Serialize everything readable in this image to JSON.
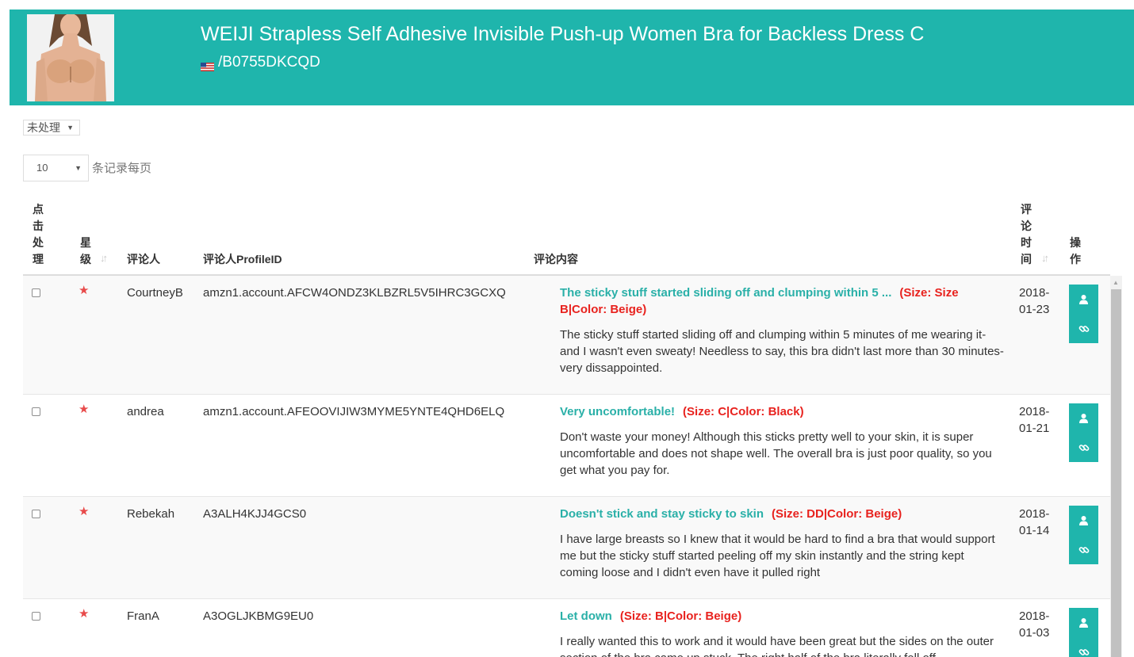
{
  "product": {
    "title": "WEIJI Strapless Self Adhesive Invisible Push-up Women Bra for Backless Dress C",
    "asin": "/B0755DKCQD",
    "flag_icon": "us-flag-icon"
  },
  "filters": {
    "status_value": "未处理",
    "page_size_value": "10",
    "page_size_label": "条记录每页"
  },
  "table": {
    "headers": {
      "process": "点击处理",
      "stars": "星级",
      "reviewer": "评论人",
      "profile_id": "评论人ProfileID",
      "content": "评论内容",
      "time": "评论时间",
      "actions": "操作"
    },
    "rows": [
      {
        "reviewer": "CourtneyB",
        "profile_id": "amzn1.account.AFCW4ONDZ3KLBZRL5V5IHRC3GCXQ",
        "title": "The sticky stuff started sliding off and clumping within 5 ...",
        "variant": "(Size: Size B|Color: Beige)",
        "body": "The sticky stuff started sliding off and clumping within 5 minutes of me wearing it- and I wasn't even sweaty! Needless to say, this bra didn't last more than 30 minutes- very dissappointed.",
        "date": "2018-01-23",
        "stars": 1
      },
      {
        "reviewer": "andrea",
        "profile_id": "amzn1.account.AFEOOVIJIW3MYME5YNTE4QHD6ELQ",
        "title": "Very uncomfortable!",
        "variant": "(Size: C|Color: Black)",
        "body": "Don't waste your money! Although this sticks pretty well to your skin, it is super uncomfortable and does not shape well. The overall bra is just poor quality, so you get what you pay for.",
        "date": "2018-01-21",
        "stars": 1
      },
      {
        "reviewer": "Rebekah",
        "profile_id": "A3ALH4KJJ4GCS0",
        "title": "Doesn't stick and stay sticky to skin",
        "variant": "(Size: DD|Color: Beige)",
        "body": "I have large breasts so I knew that it would be hard to find a bra that would support me but the sticky stuff started peeling off my skin instantly and the string kept coming loose and I didn't even have it pulled right",
        "date": "2018-01-14",
        "stars": 1
      },
      {
        "reviewer": "FranA",
        "profile_id": "A3OGLJKBMG9EU0",
        "title": "Let down",
        "variant": "(Size: B|Color: Beige)",
        "body": "I really wanted this to work and it would have been great but the sides on the outer section of the bra came up stuck. The right half of the bra literally fell off",
        "date": "2018-01-03",
        "stars": 1
      }
    ]
  },
  "icons": {
    "star": "star-icon",
    "user": "user-icon",
    "link": "link-icon",
    "sort": "sort-icon",
    "caret": "caret-down-icon"
  },
  "colors": {
    "accent": "#1fb5ac",
    "title_text": "#2ab0a8",
    "variant_text": "#e8221e",
    "star": "#e84a4a"
  }
}
